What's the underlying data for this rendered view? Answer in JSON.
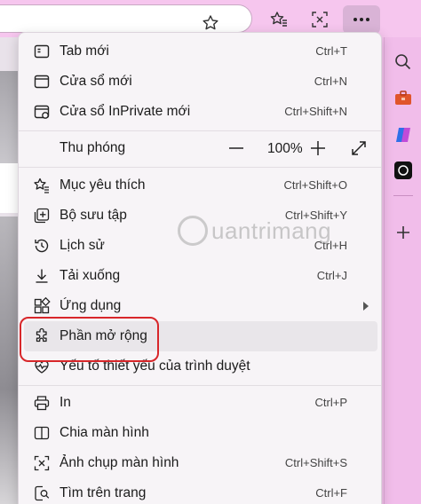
{
  "menu": {
    "new_tab": {
      "label": "Tab mới",
      "shortcut": "Ctrl+T"
    },
    "new_window": {
      "label": "Cửa sổ mới",
      "shortcut": "Ctrl+N"
    },
    "new_inprivate": {
      "label": "Cửa sổ InPrivate mới",
      "shortcut": "Ctrl+Shift+N"
    },
    "zoom": {
      "label": "Thu phóng",
      "minus": "—",
      "value": "100%",
      "plus": "+"
    },
    "favorites": {
      "label": "Mục yêu thích",
      "shortcut": "Ctrl+Shift+O"
    },
    "collections": {
      "label": "Bộ sưu tập",
      "shortcut": "Ctrl+Shift+Y"
    },
    "history": {
      "label": "Lịch sử",
      "shortcut": "Ctrl+H"
    },
    "downloads": {
      "label": "Tải xuống",
      "shortcut": "Ctrl+J"
    },
    "apps": {
      "label": "Ứng dụng"
    },
    "extensions": {
      "label": "Phần mở rộng"
    },
    "browser_essentials": {
      "label": "Yếu tố thiết yếu của trình duyệt"
    },
    "print": {
      "label": "In",
      "shortcut": "Ctrl+P"
    },
    "split_screen": {
      "label": "Chia màn hình"
    },
    "screenshot": {
      "label": "Ảnh chụp màn hình",
      "shortcut": "Ctrl+Shift+S"
    },
    "find": {
      "label": "Tìm trên trang",
      "shortcut": "Ctrl+F"
    }
  },
  "watermark": {
    "text": "uantrimang"
  },
  "colors": {
    "highlight_border": "#d8262a",
    "menu_bg": "#f7f4f7",
    "chrome_bg": "#f6c6ee"
  }
}
